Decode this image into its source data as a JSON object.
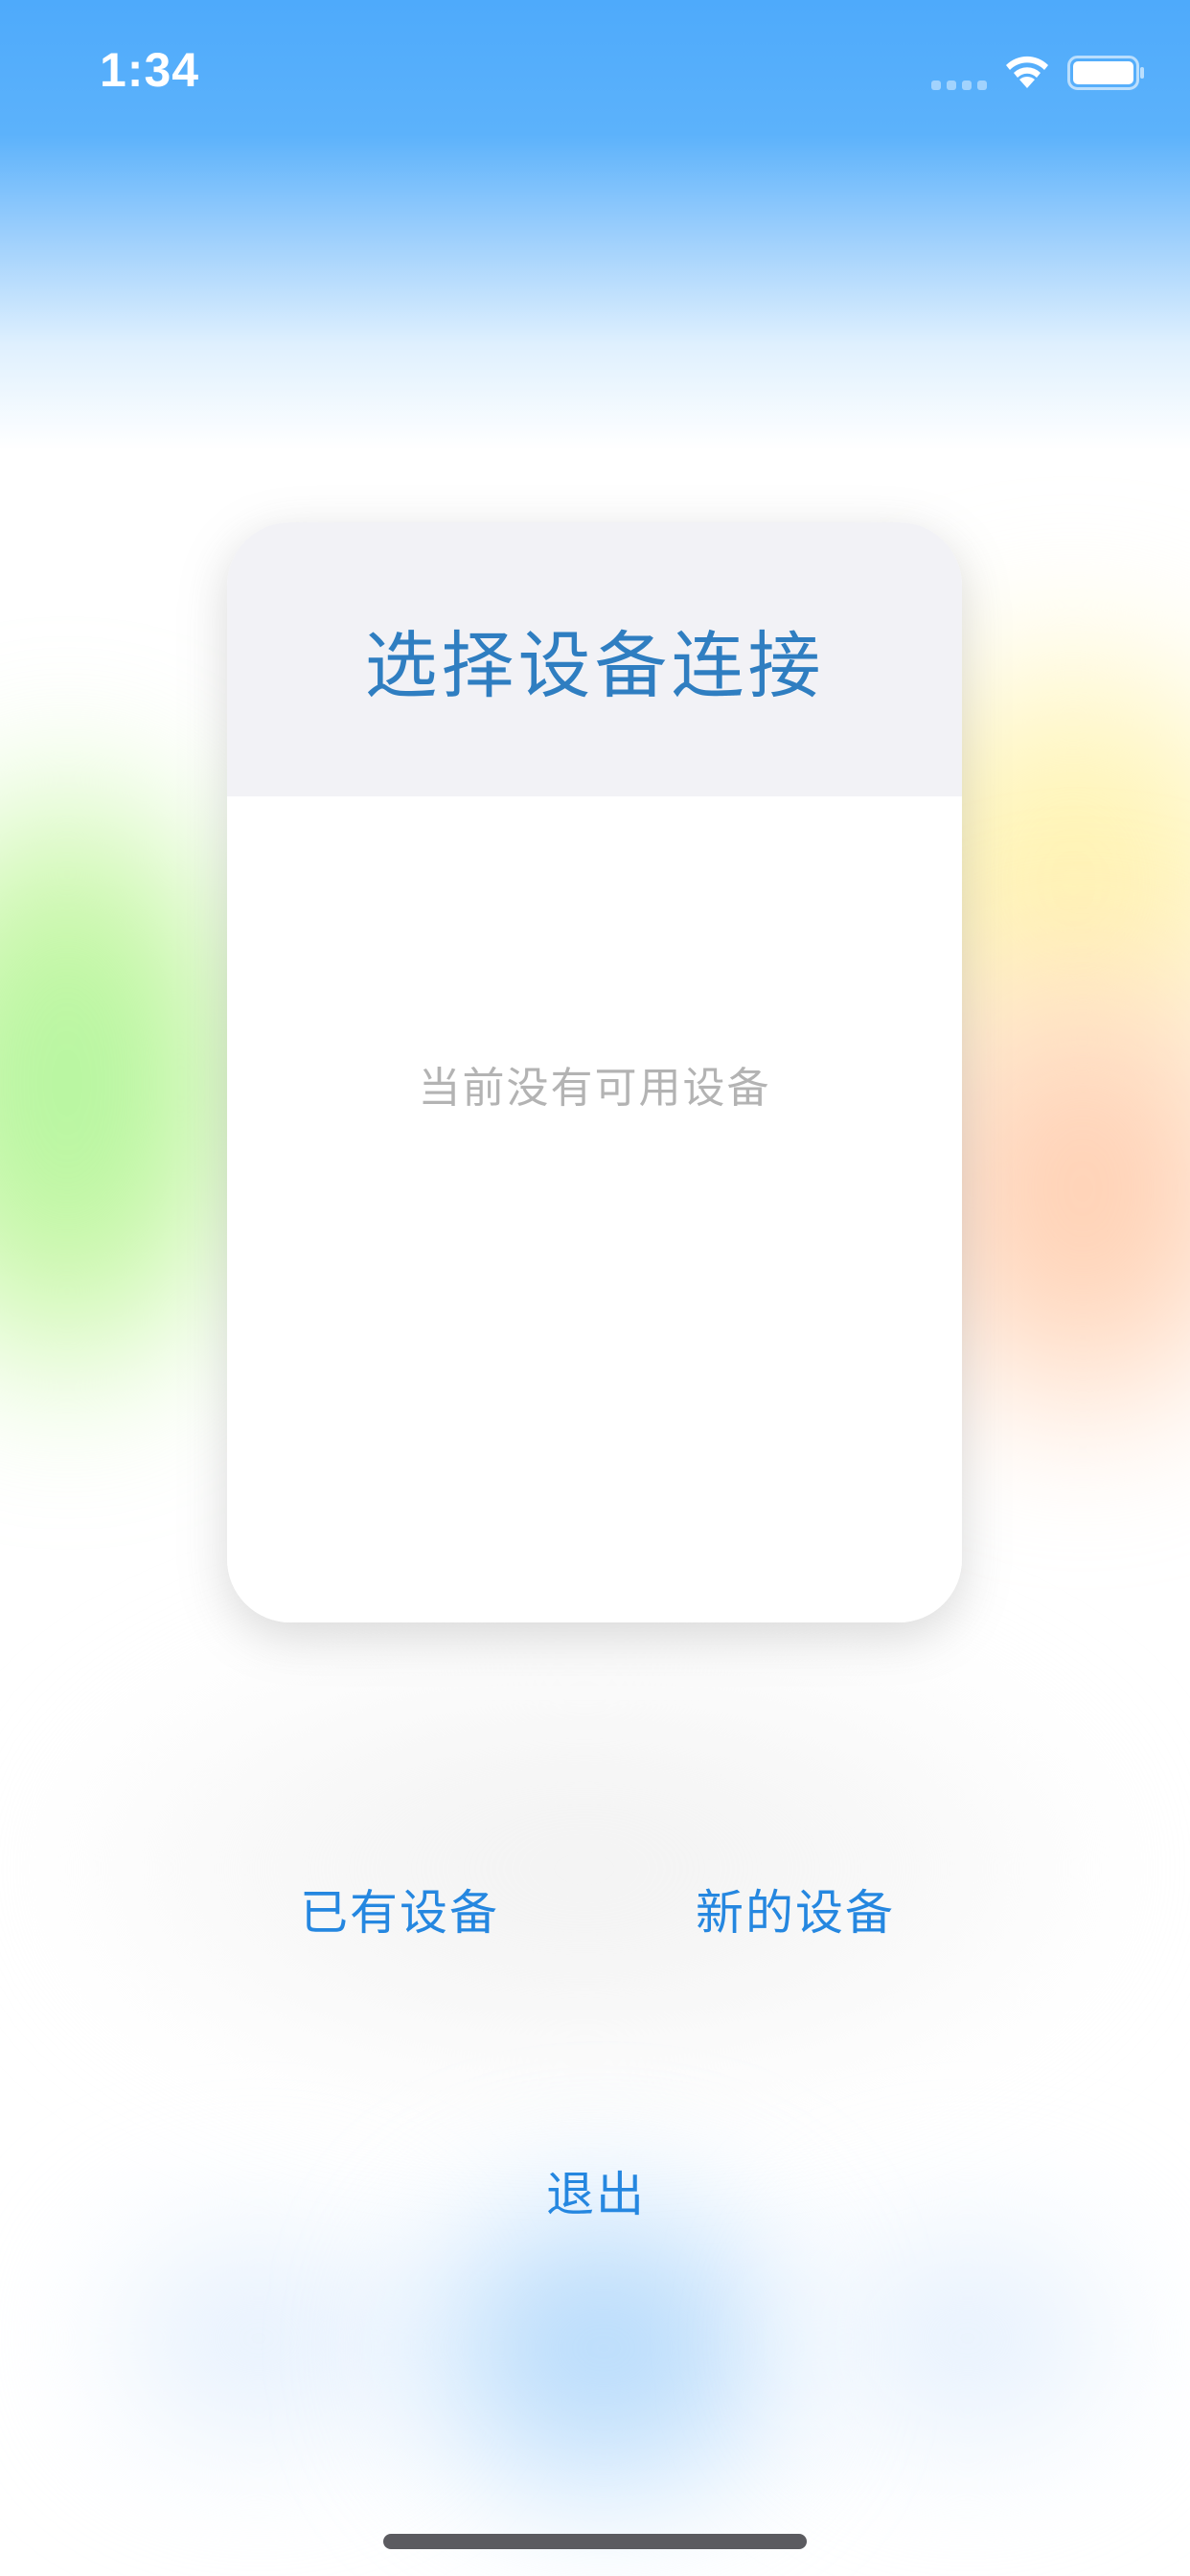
{
  "status_bar": {
    "time": "1:34",
    "icons": [
      "signal-icon",
      "wifi-icon",
      "battery-icon"
    ]
  },
  "dialog": {
    "title": "选择设备连接",
    "empty_message": "当前没有可用设备"
  },
  "actions": {
    "existing_device": "已有设备",
    "new_device": "新的设备",
    "exit": "退出"
  },
  "colors": {
    "accent": "#2587e0",
    "title": "#2f7ec1",
    "header_bg": "#f2f2f6",
    "muted_text": "#b3b3b3",
    "status_bar_bg": "#4eaafb"
  }
}
